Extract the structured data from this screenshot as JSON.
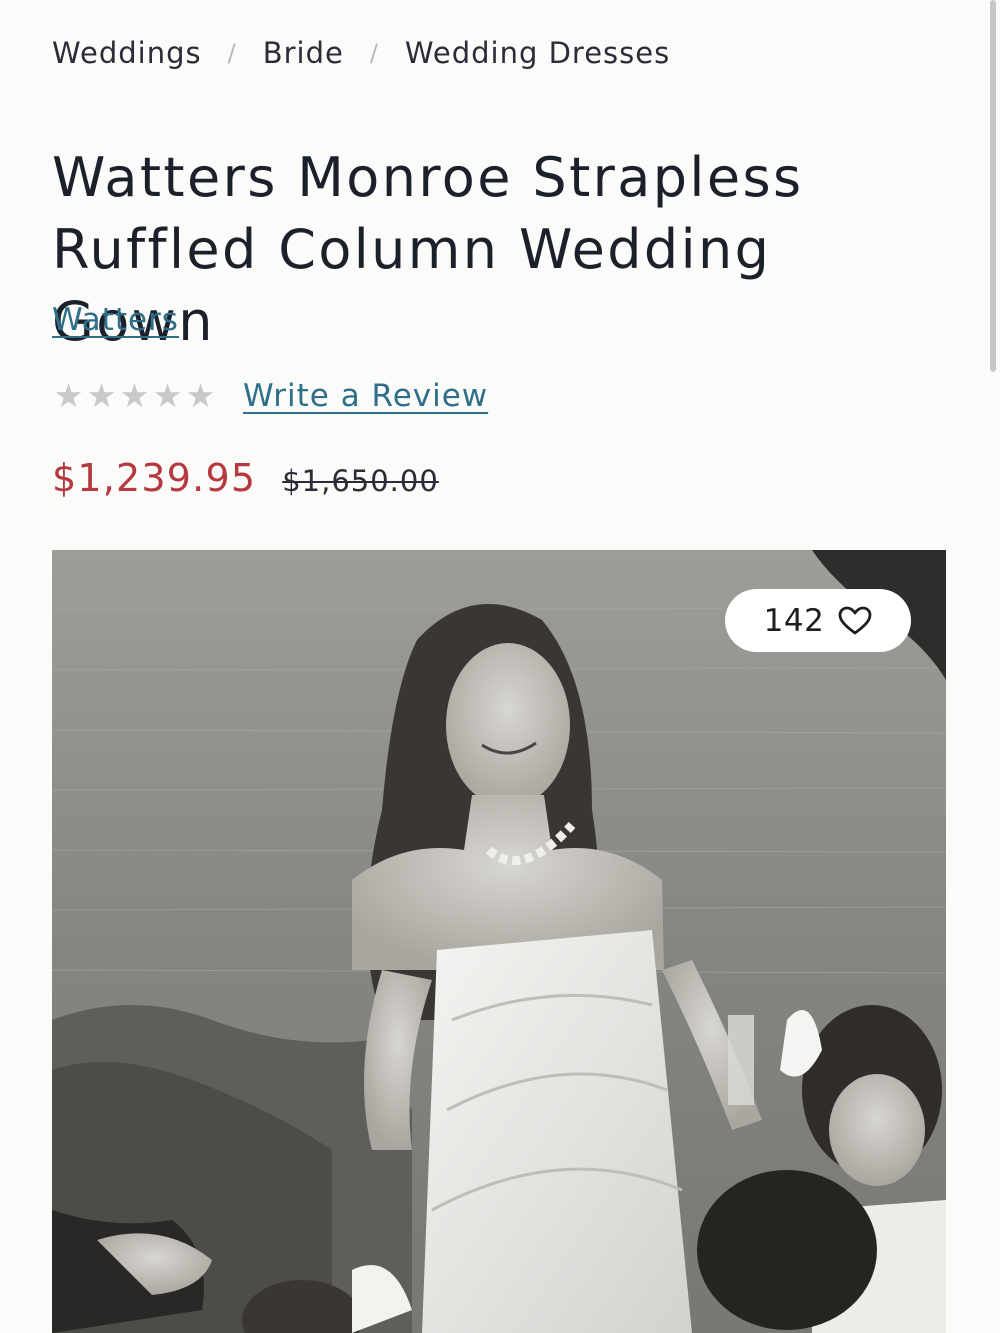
{
  "breadcrumb": {
    "items": [
      "Weddings",
      "Bride",
      "Wedding Dresses"
    ],
    "separator": "/"
  },
  "product": {
    "title": "Watters Monroe Strapless Ruffled Column Wedding Gown",
    "brand": "Watters",
    "rating": {
      "stars_filled": 0,
      "stars_total": 5,
      "review_link": "Write a Review"
    },
    "price": {
      "sale": "$1,239.95",
      "original": "$1,650.00"
    },
    "favorites": {
      "count": "142",
      "icon": "heart-icon"
    },
    "image": {
      "alt": "Bride in strapless white column gown with flower girls by the water"
    }
  },
  "colors": {
    "link": "#2f6f8a",
    "sale_price": "#b5393e",
    "star_empty": "#c9c9c9",
    "background": "#fbfbf9"
  }
}
